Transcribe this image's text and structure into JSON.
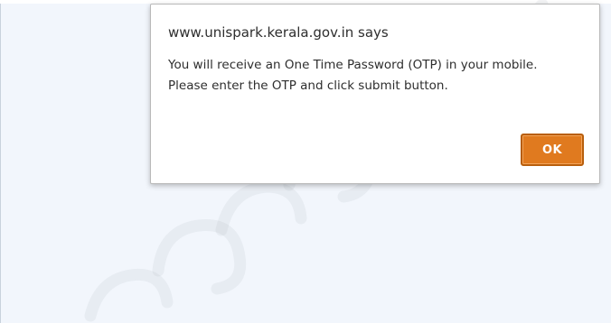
{
  "dialog": {
    "title": "www.unispark.kerala.gov.in says",
    "message": "You will receive an One Time Password (OTP) in your mobile. Please enter the OTP and click submit button.",
    "ok_label": "OK"
  },
  "colors": {
    "page_background": "#f2f6fc",
    "accent_button": "#e07a1f",
    "button_border": "#b85e0c",
    "dialog_background": "#ffffff"
  }
}
